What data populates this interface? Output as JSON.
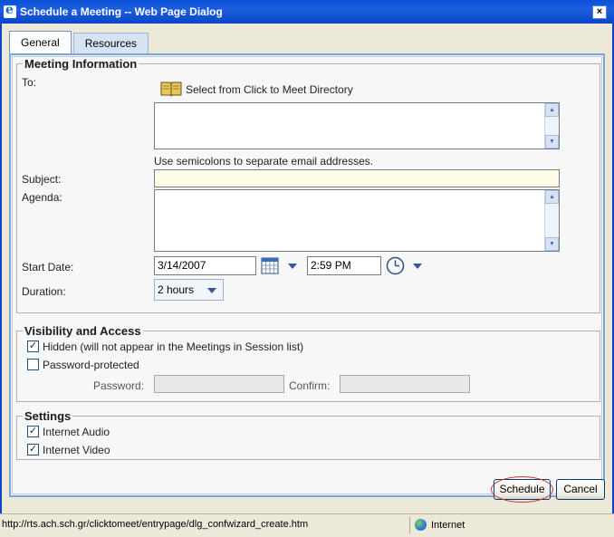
{
  "window": {
    "title": "Schedule a Meeting -- Web Page Dialog",
    "close_glyph": "×"
  },
  "tabs": [
    {
      "label": "General",
      "active": true
    },
    {
      "label": "Resources",
      "active": false
    }
  ],
  "meeting_info": {
    "legend": "Meeting Information",
    "to_label": "To:",
    "directory_link": "Select from Click to Meet Directory",
    "to_value": "",
    "hint": "Use semicolons to separate email addresses.",
    "subject_label": "Subject:",
    "subject_value": "",
    "agenda_label": "Agenda:",
    "agenda_value": "",
    "start_date_label": "Start Date:",
    "start_date_value": "3/14/2007",
    "start_time_value": "2:59 PM",
    "duration_label": "Duration:",
    "duration_value": "2 hours"
  },
  "visibility": {
    "legend": "Visibility and Access",
    "hidden_label": "Hidden (will not appear in the Meetings in Session list)",
    "hidden_checked": true,
    "password_protected_label": "Password-protected",
    "password_protected_checked": false,
    "password_label": "Password:",
    "confirm_label": "Confirm:"
  },
  "settings": {
    "legend": "Settings",
    "audio_label": "Internet Audio",
    "audio_checked": true,
    "video_label": "Internet Video",
    "video_checked": true
  },
  "buttons": {
    "schedule": "Schedule",
    "cancel": "Cancel"
  },
  "status": {
    "url": "http://rts.ach.sch.gr/clicktomeet/entrypage/dlg_confwizard_create.htm",
    "zone": "Internet"
  },
  "colors": {
    "title_bar": "#0a4fd6",
    "panel_border": "#7ea4dc",
    "subject_bg": "#fffbe4",
    "schedule_highlight": "#c83232"
  },
  "icons": {
    "directory": "book-icon",
    "calendar": "calendar-icon",
    "clock": "clock-icon",
    "zone": "globe-icon"
  }
}
